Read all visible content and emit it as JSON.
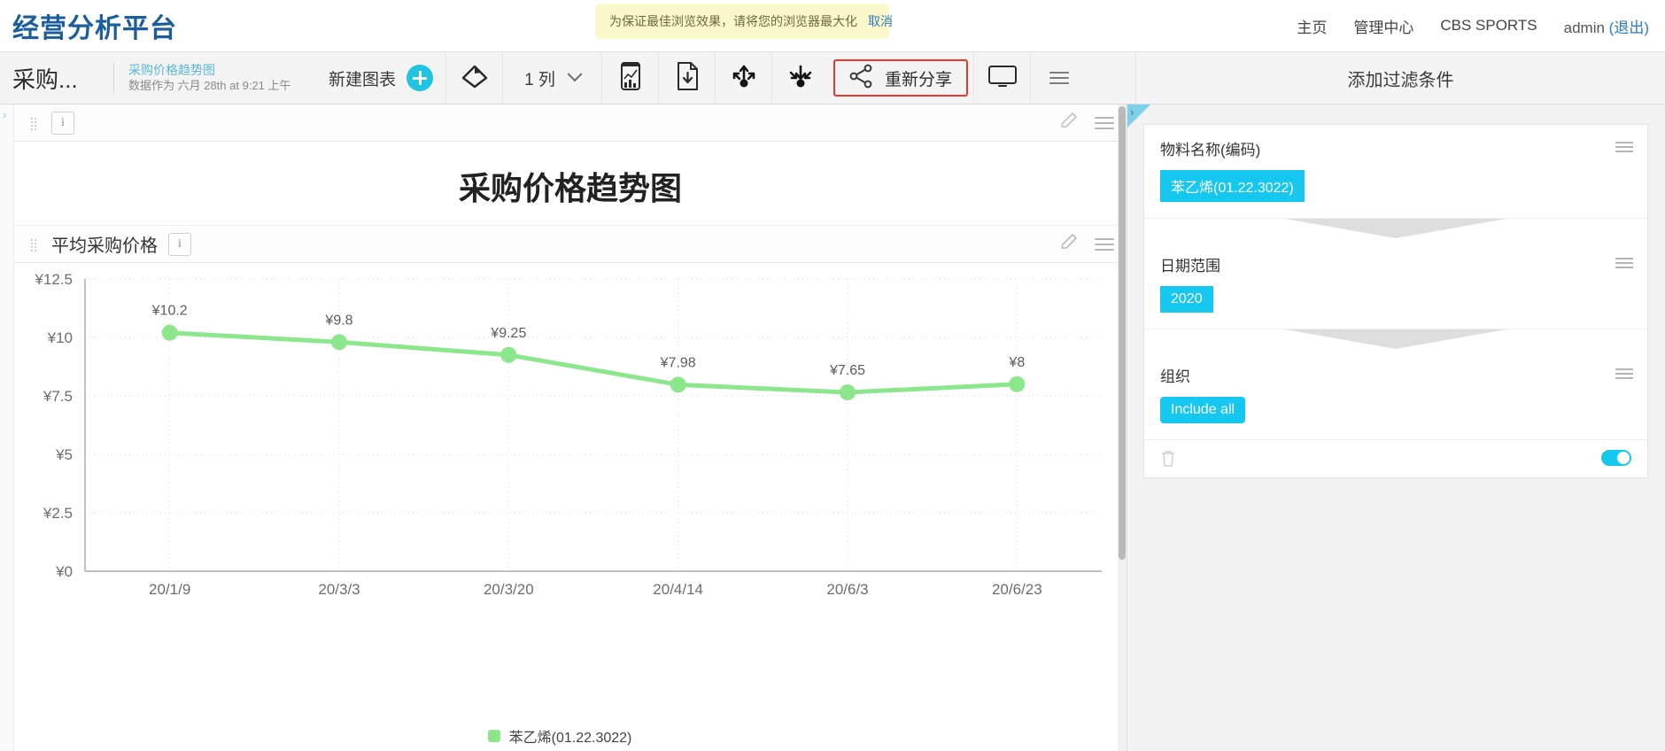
{
  "header": {
    "brand": "经营分析平台",
    "banner": {
      "text": "为保证最佳浏览效果，请将您的浏览器最大化",
      "cancel": "取消"
    },
    "nav": [
      {
        "label": "主页"
      },
      {
        "label": "管理中心"
      },
      {
        "label": "CBS SPORTS"
      }
    ],
    "user": {
      "name": "admin",
      "logout": "(退出)"
    }
  },
  "toolbar": {
    "workspace_title": "采购...",
    "dashboard_name": "采购价格趋势图",
    "dashboard_time": "数据作为 六月 28th at 9:21 上午",
    "new_chart_label": "新建图表",
    "column_select": "1 列",
    "share_label": "重新分享",
    "add_filter_label": "添加过滤条件",
    "icons": {
      "edit_shape": "edit-shape-icon",
      "mobile_chart": "mobile-chart-icon",
      "file_download": "file-download-icon",
      "expand_all": "expand-all-icon",
      "collapse_all": "collapse-all-icon",
      "share": "share-nodes-icon",
      "presentation": "presentation-screen-icon",
      "menu": "hamburger-menu-icon"
    }
  },
  "dashboard": {
    "title": "采购价格趋势图",
    "card_title": "平均采购价格",
    "info_glyph": "i"
  },
  "chart_data": {
    "type": "line",
    "title": "平均采购价格",
    "categories": [
      "20/1/9",
      "20/3/3",
      "20/3/20",
      "20/4/14",
      "20/6/3",
      "20/6/23"
    ],
    "values": [
      10.2,
      9.8,
      9.25,
      7.98,
      7.65,
      8
    ],
    "point_labels": [
      "¥10.2",
      "¥9.8",
      "¥9.25",
      "¥7.98",
      "¥7.65",
      "¥8"
    ],
    "ylabel": "",
    "xlabel": "",
    "ylim": [
      0,
      12.5
    ],
    "yticks": [
      0,
      2.5,
      5,
      7.5,
      10,
      12.5
    ],
    "ytick_labels": [
      "¥0",
      "¥2.5",
      "¥5",
      "¥7.5",
      "¥10",
      "¥12.5"
    ],
    "grid": true,
    "legend_position": "bottom",
    "series": [
      {
        "name": "苯乙烯(01.22.3022)",
        "color": "#8ce68c",
        "values": [
          10.2,
          9.8,
          9.25,
          7.98,
          7.65,
          8
        ]
      }
    ]
  },
  "filters": {
    "blocks": [
      {
        "label": "物料名称(编码)",
        "value": "苯乙烯(01.22.3022)"
      },
      {
        "label": "日期范围",
        "value": "2020"
      },
      {
        "label": "组织",
        "value": "Include all"
      }
    ]
  },
  "colors": {
    "brand": "#1b5e9e",
    "accent": "#16c7ef",
    "series_green": "#8ce68c",
    "alert_outline": "#e8372e",
    "banner_bg": "#fbf8cc"
  }
}
